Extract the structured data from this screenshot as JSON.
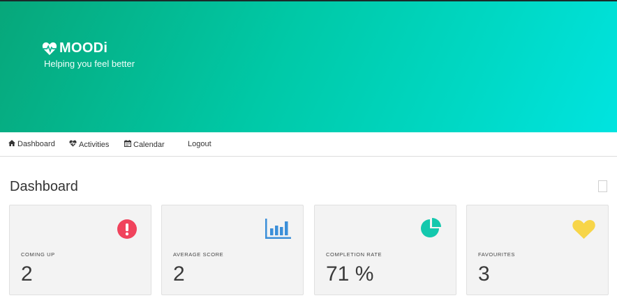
{
  "brand": {
    "title": "MOODi",
    "tagline": "Helping you feel better"
  },
  "nav": {
    "items": [
      {
        "label": "Dashboard",
        "icon": "home-icon"
      },
      {
        "label": "Activities",
        "icon": "heartbeat-icon"
      },
      {
        "label": "Calendar",
        "icon": "calendar-icon"
      },
      {
        "label": "Logout",
        "icon": ""
      }
    ]
  },
  "page": {
    "title": "Dashboard"
  },
  "cards": [
    {
      "label": "COMING UP",
      "value": "2",
      "icon": "exclamation-circle-icon",
      "icon_color": "#f0435c"
    },
    {
      "label": "AVERAGE SCORE",
      "value": "2",
      "icon": "bar-chart-icon",
      "icon_color": "#3b8fd9"
    },
    {
      "label": "COMPLETION RATE",
      "value": "71 %",
      "icon": "pie-chart-icon",
      "icon_color": "#13c8ad"
    },
    {
      "label": "FAVOURITES",
      "value": "3",
      "icon": "heart-icon",
      "icon_color": "#f7d549"
    }
  ],
  "colors": {
    "hero_start": "#07a77a",
    "hero_end": "#00e4e0"
  }
}
